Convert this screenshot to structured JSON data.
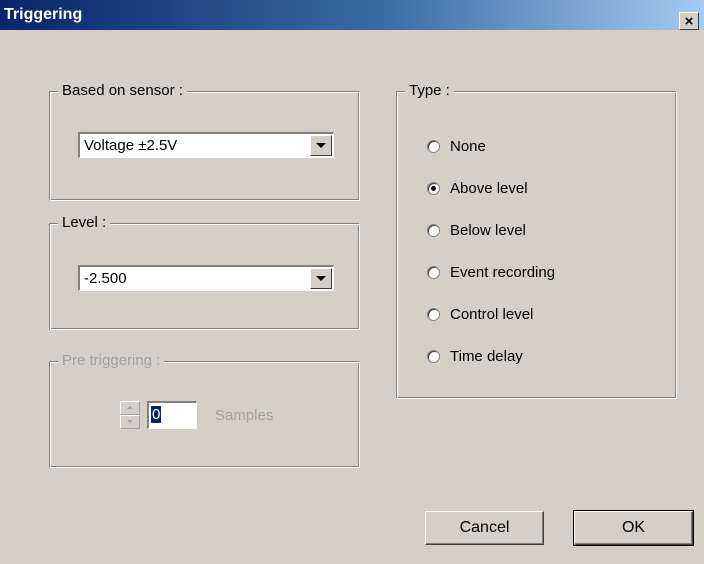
{
  "window": {
    "title": "Triggering",
    "close_glyph": "×"
  },
  "sensor_group": {
    "label": "Based on sensor :",
    "selected": "Voltage ±2.5V"
  },
  "level_group": {
    "label": "Level :",
    "selected": "-2.500"
  },
  "pretrigger_group": {
    "label": "Pre triggering :",
    "value": "0",
    "unit": "Samples",
    "enabled": false
  },
  "type_group": {
    "label": "Type :",
    "options": [
      {
        "label": "None",
        "checked": false
      },
      {
        "label": "Above level",
        "checked": true
      },
      {
        "label": "Below level",
        "checked": false
      },
      {
        "label": "Event recording",
        "checked": false
      },
      {
        "label": "Control level",
        "checked": false
      },
      {
        "label": "Time delay",
        "checked": false
      }
    ]
  },
  "buttons": {
    "cancel": "Cancel",
    "ok": "OK"
  },
  "colors": {
    "face": "#d4d0c8",
    "title_start": "#0a246a",
    "title_end": "#a6caf0",
    "disabled_text": "#a0a0a0"
  }
}
